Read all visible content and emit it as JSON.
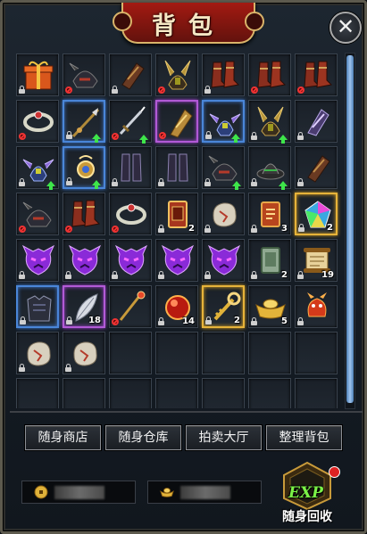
{
  "title": "背包",
  "close_label": "✕",
  "buttons": {
    "shop": "随身商店",
    "storage": "随身仓库",
    "auction": "拍卖大厅",
    "sort": "整理背包"
  },
  "recycle": {
    "badge": "EXP",
    "label": "随身回收"
  },
  "currency": {
    "gold_value": "",
    "ingot_value": ""
  },
  "colors": {
    "quality_blue": "#4a86d8",
    "quality_purple": "#b25ad6",
    "quality_gold": "#e6b33a",
    "upgrade_arrow": "#3ee54a"
  },
  "slots": [
    {
      "icon": "gift-box-icon",
      "q": "",
      "lock": "lock",
      "up": false,
      "count": ""
    },
    {
      "icon": "dark-helmet-icon",
      "q": "",
      "lock": "ban",
      "up": false,
      "count": ""
    },
    {
      "icon": "bracer-icon",
      "q": "",
      "lock": "lock",
      "up": false,
      "count": ""
    },
    {
      "icon": "horned-helmet-icon",
      "q": "",
      "lock": "ban",
      "up": false,
      "count": ""
    },
    {
      "icon": "boots-icon",
      "q": "",
      "lock": "lock",
      "up": false,
      "count": ""
    },
    {
      "icon": "boots-icon",
      "q": "",
      "lock": "ban",
      "up": false,
      "count": ""
    },
    {
      "icon": "boots-icon",
      "q": "",
      "lock": "ban",
      "up": false,
      "count": ""
    },
    {
      "icon": "ring-icon",
      "q": "",
      "lock": "ban",
      "up": false,
      "count": ""
    },
    {
      "icon": "spear-icon",
      "q": "blue",
      "lock": "lock",
      "up": true,
      "count": ""
    },
    {
      "icon": "sword-icon",
      "q": "",
      "lock": "ban",
      "up": true,
      "count": ""
    },
    {
      "icon": "gold-bracer-icon",
      "q": "purple",
      "lock": "ban",
      "up": false,
      "count": ""
    },
    {
      "icon": "winged-helmet-icon",
      "q": "blue",
      "lock": "lock",
      "up": true,
      "count": ""
    },
    {
      "icon": "horned-helmet-icon",
      "q": "",
      "lock": "lock",
      "up": true,
      "count": ""
    },
    {
      "icon": "gauntlet-icon",
      "q": "",
      "lock": "lock",
      "up": false,
      "count": ""
    },
    {
      "icon": "winged-helmet-icon",
      "q": "",
      "lock": "lock",
      "up": true,
      "count": ""
    },
    {
      "icon": "amulet-icon",
      "q": "blue",
      "lock": "lock",
      "up": true,
      "count": ""
    },
    {
      "icon": "greaves-icon",
      "q": "",
      "lock": "lock",
      "up": false,
      "count": ""
    },
    {
      "icon": "greaves-icon",
      "q": "",
      "lock": "lock",
      "up": false,
      "count": ""
    },
    {
      "icon": "dark-helmet-icon",
      "q": "",
      "lock": "lock",
      "up": true,
      "count": ""
    },
    {
      "icon": "dark-hat-icon",
      "q": "",
      "lock": "lock",
      "up": true,
      "count": ""
    },
    {
      "icon": "bracer-icon",
      "q": "",
      "lock": "lock",
      "up": false,
      "count": ""
    },
    {
      "icon": "dark-helmet-icon",
      "q": "",
      "lock": "ban",
      "up": false,
      "count": ""
    },
    {
      "icon": "boots-icon",
      "q": "",
      "lock": "ban",
      "up": false,
      "count": ""
    },
    {
      "icon": "ring-icon",
      "q": "",
      "lock": "ban",
      "up": false,
      "count": ""
    },
    {
      "icon": "scroll-book-icon",
      "q": "",
      "lock": "lock",
      "up": false,
      "count": "2"
    },
    {
      "icon": "ore-stone-icon",
      "q": "",
      "lock": "lock",
      "up": false,
      "count": ""
    },
    {
      "icon": "rune-book-icon",
      "q": "",
      "lock": "lock",
      "up": false,
      "count": "3"
    },
    {
      "icon": "rainbow-gem-icon",
      "q": "gold",
      "lock": "lock",
      "up": false,
      "count": "2"
    },
    {
      "icon": "demon-mask-icon",
      "q": "",
      "lock": "lock",
      "up": false,
      "count": ""
    },
    {
      "icon": "demon-mask-icon",
      "q": "",
      "lock": "lock",
      "up": false,
      "count": ""
    },
    {
      "icon": "demon-mask-icon",
      "q": "",
      "lock": "lock",
      "up": false,
      "count": ""
    },
    {
      "icon": "demon-mask-icon",
      "q": "",
      "lock": "lock",
      "up": false,
      "count": ""
    },
    {
      "icon": "demon-mask-icon",
      "q": "",
      "lock": "lock",
      "up": false,
      "count": ""
    },
    {
      "icon": "jade-book-icon",
      "q": "",
      "lock": "lock",
      "up": false,
      "count": "2"
    },
    {
      "icon": "scroll-icon",
      "q": "",
      "lock": "lock",
      "up": false,
      "count": "19"
    },
    {
      "icon": "dark-armor-icon",
      "q": "blue",
      "lock": "lock",
      "up": false,
      "count": ""
    },
    {
      "icon": "feather-icon",
      "q": "purple",
      "lock": "lock",
      "up": false,
      "count": "18"
    },
    {
      "icon": "golden-staff-icon",
      "q": "",
      "lock": "ban",
      "up": false,
      "count": ""
    },
    {
      "icon": "red-orb-icon",
      "q": "",
      "lock": "lock",
      "up": false,
      "count": "14"
    },
    {
      "icon": "golden-key-icon",
      "q": "gold",
      "lock": "lock",
      "up": false,
      "count": "2"
    },
    {
      "icon": "gold-ingot-icon",
      "q": "",
      "lock": "lock",
      "up": false,
      "count": "5"
    },
    {
      "icon": "red-pet-icon",
      "q": "",
      "lock": "lock",
      "up": false,
      "count": ""
    },
    {
      "icon": "ore-stone-icon",
      "q": "",
      "lock": "lock",
      "up": false,
      "count": ""
    },
    {
      "icon": "ore-stone-icon",
      "q": "",
      "lock": "lock",
      "up": false,
      "count": ""
    },
    {
      "icon": "",
      "q": "",
      "lock": "",
      "up": false,
      "count": ""
    },
    {
      "icon": "",
      "q": "",
      "lock": "",
      "up": false,
      "count": ""
    },
    {
      "icon": "",
      "q": "",
      "lock": "",
      "up": false,
      "count": ""
    },
    {
      "icon": "",
      "q": "",
      "lock": "",
      "up": false,
      "count": ""
    },
    {
      "icon": "",
      "q": "",
      "lock": "",
      "up": false,
      "count": ""
    },
    {
      "icon": "",
      "q": "",
      "lock": "",
      "up": false,
      "count": ""
    },
    {
      "icon": "",
      "q": "",
      "lock": "",
      "up": false,
      "count": ""
    },
    {
      "icon": "",
      "q": "",
      "lock": "",
      "up": false,
      "count": ""
    },
    {
      "icon": "",
      "q": "",
      "lock": "",
      "up": false,
      "count": ""
    },
    {
      "icon": "",
      "q": "",
      "lock": "",
      "up": false,
      "count": ""
    },
    {
      "icon": "",
      "q": "",
      "lock": "",
      "up": false,
      "count": ""
    },
    {
      "icon": "",
      "q": "",
      "lock": "",
      "up": false,
      "count": ""
    }
  ]
}
